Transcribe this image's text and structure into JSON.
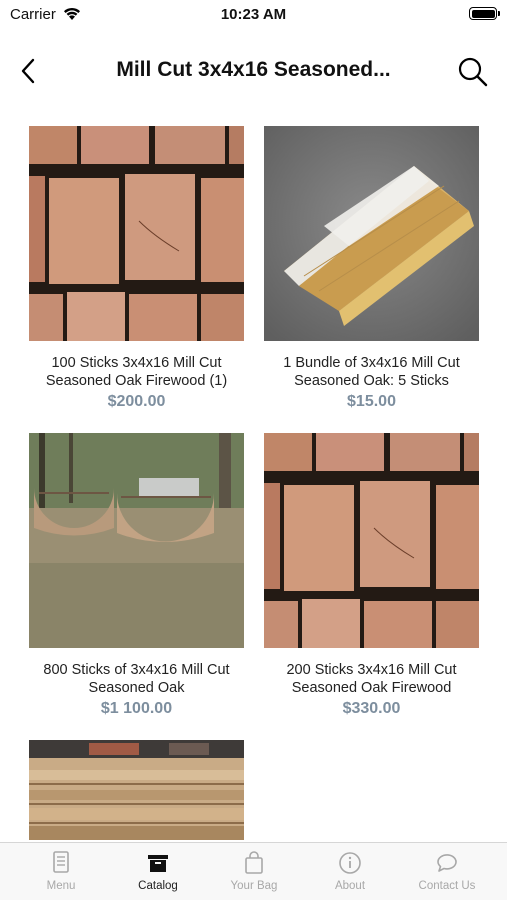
{
  "status_bar": {
    "carrier": "Carrier",
    "time": "10:23 AM"
  },
  "nav": {
    "title": "Mill Cut 3x4x16 Seasoned..."
  },
  "products": [
    {
      "title": "100 Sticks 3x4x16 Mill Cut Seasoned Oak Firewood (1)",
      "price": "$200.00",
      "image": "stacked-wood-ends"
    },
    {
      "title": "1 Bundle of  3x4x16 Mill Cut Seasoned Oak: 5 Sticks",
      "price": "$15.00",
      "image": "wrapped-bundle"
    },
    {
      "title": "800 Sticks of 3x4x16 Mill Cut Seasoned Oak",
      "price": "$1 100.00",
      "image": "yard-wood-piles"
    },
    {
      "title": "200 Sticks 3x4x16 Mill Cut Seasoned Oak Firewood",
      "price": "$330.00",
      "image": "stacked-wood-ends"
    },
    {
      "title": "",
      "price": "",
      "image": "lumber-stack"
    }
  ],
  "tab_bar": {
    "tabs": [
      {
        "label": "Menu",
        "icon": "menu-icon",
        "active": false
      },
      {
        "label": "Catalog",
        "icon": "catalog-icon",
        "active": true
      },
      {
        "label": "Your Bag",
        "icon": "bag-icon",
        "active": false
      },
      {
        "label": "About",
        "icon": "info-icon",
        "active": false
      },
      {
        "label": "Contact Us",
        "icon": "chat-icon",
        "active": false
      }
    ]
  },
  "colors": {
    "price": "#7d8e9e",
    "inactive_tab": "#a8a8a8",
    "active_tab": "#222222"
  }
}
